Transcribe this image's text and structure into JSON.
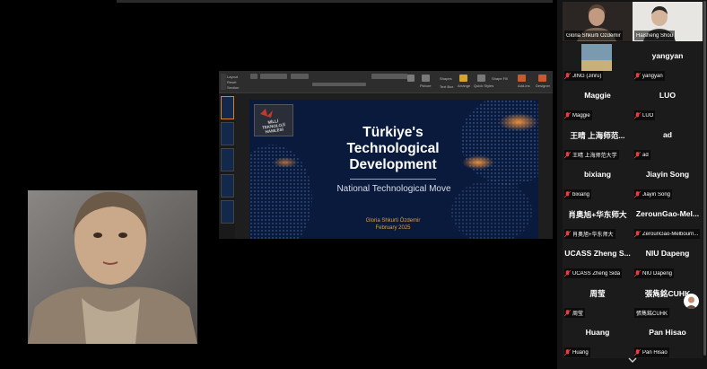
{
  "slide": {
    "title": "Türkiye's Technological Development",
    "subtitle": "National Technological Move",
    "author": "Gloria Shkurti Özdemir",
    "date": "February 2025",
    "logo_text": "MİLLİ TEKNOLOJİ HAMLESİ"
  },
  "ribbon": {
    "left_items": [
      "Layout",
      "Reset",
      "Section"
    ],
    "groups": [
      "Picture",
      "Shapes",
      "Text Box",
      "Arrange",
      "Quick Styles",
      "Shape Fill",
      "Designer",
      "Add-ins"
    ],
    "camera_label": "(Cameo)"
  },
  "participants": [
    {
      "name": "Gloria Shkurti Özdemir",
      "label": "Gloria Shkurti Özdemir",
      "video": true,
      "active": true
    },
    {
      "name": "Haisheng Shou",
      "label": "Haisheng Shou",
      "video": true
    },
    {
      "name": "JING",
      "label": "JING (Jinru)",
      "video": true
    },
    {
      "name": "yangyan",
      "label": "yangyan"
    },
    {
      "name": "Maggie",
      "label": "Maggie"
    },
    {
      "name": "LUO",
      "label": "LUO"
    },
    {
      "name": "王晴 上海师范...",
      "label": "王晴 上海师范大学"
    },
    {
      "name": "ad",
      "label": "ad"
    },
    {
      "name": "bixiang",
      "label": "bixiang"
    },
    {
      "name": "Jiayin Song",
      "label": "Jiayin Song"
    },
    {
      "name": "肖奥旭+华东师大",
      "label": "肖奥旭+华东师大"
    },
    {
      "name": "ZerounGao-Mel...",
      "label": "ZerounGao-Melbourn..."
    },
    {
      "name": "UCASS Zheng S...",
      "label": "UCASS Zheng Sida"
    },
    {
      "name": "NIU Dapeng",
      "label": "NIU Dapeng"
    },
    {
      "name": "周莹",
      "label": "周莹"
    },
    {
      "name": "張雋銘CUHK",
      "label": "張雋銘CUHK"
    },
    {
      "name": "Huang",
      "label": "Huang"
    },
    {
      "name": "Pan Hisao",
      "label": "Pan Hisao"
    }
  ],
  "colors": {
    "active_border": "#2bbd6e",
    "muted_mic": "#e04040",
    "accent": "#d9822b"
  }
}
